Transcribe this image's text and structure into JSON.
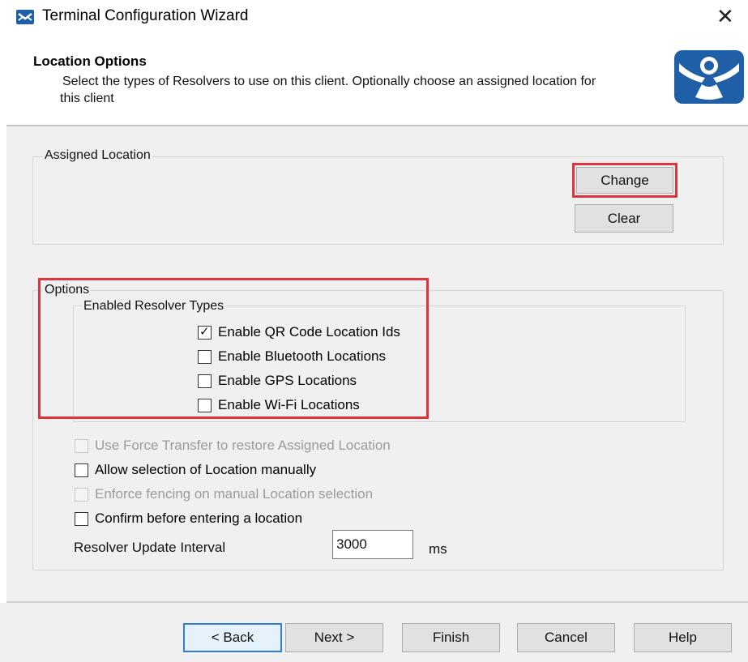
{
  "window": {
    "title": "Terminal Configuration Wizard",
    "close_label": "✕"
  },
  "header": {
    "title": "Location Options",
    "description_line1": "Select the types of Resolvers to use on this client. Optionally choose an assigned location for",
    "description_line2": "this client",
    "logo_icon": "thinmanager-logo"
  },
  "assigned_location": {
    "label": "Assigned Location",
    "change_label": "Change",
    "clear_label": "Clear"
  },
  "options": {
    "label": "Options",
    "resolver_types": {
      "label": "Enabled Resolver Types",
      "items": [
        {
          "label": "Enable QR Code Location Ids",
          "checked": true
        },
        {
          "label": "Enable Bluetooth Locations",
          "checked": false
        },
        {
          "label": "Enable GPS Locations",
          "checked": false
        },
        {
          "label": "Enable Wi-Fi Locations",
          "checked": false
        }
      ]
    },
    "settings": [
      {
        "label": "Use Force Transfer to restore Assigned Location",
        "checked": false,
        "enabled": false
      },
      {
        "label": "Allow selection of Location manually",
        "checked": false,
        "enabled": true
      },
      {
        "label": "Enforce fencing on manual Location selection",
        "checked": false,
        "enabled": false
      },
      {
        "label": "Confirm before entering a location",
        "checked": false,
        "enabled": true
      }
    ],
    "interval": {
      "label": "Resolver Update Interval",
      "value": "3000",
      "unit": "ms"
    }
  },
  "footer": {
    "back_label": "< Back",
    "next_label": "Next >",
    "finish_label": "Finish",
    "cancel_label": "Cancel",
    "help_label": "Help"
  },
  "colors": {
    "highlight": "#e0333d",
    "focus": "#2f7ed8",
    "logo_blue": "#1f5fa8"
  }
}
